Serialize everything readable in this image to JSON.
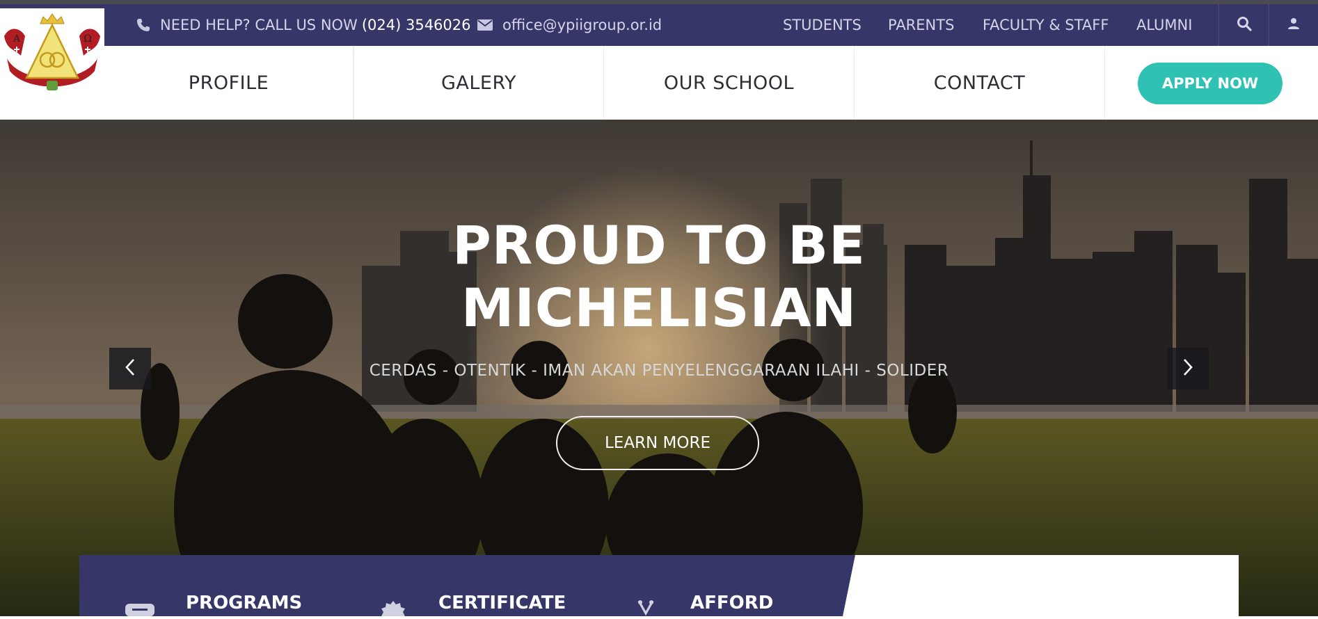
{
  "topbar": {
    "help_text": "NEED HELP? CALL US NOW",
    "phone": "(024) 3546026",
    "email": "office@ypiigroup.or.id",
    "links": [
      {
        "label": "STUDENTS"
      },
      {
        "label": "PARENTS"
      },
      {
        "label": "FACULTY & STAFF"
      },
      {
        "label": "ALUMNI"
      }
    ],
    "icons": {
      "phone": "phone-icon",
      "email": "envelope-icon",
      "search": "search-icon",
      "user": "user-icon"
    }
  },
  "logo": {
    "left_letter": "Α",
    "right_letter": "Ω"
  },
  "nav": {
    "items": [
      {
        "label": "PROFILE"
      },
      {
        "label": "GALERY"
      },
      {
        "label": "OUR SCHOOL"
      },
      {
        "label": "CONTACT"
      }
    ],
    "apply": "APPLY NOW"
  },
  "hero": {
    "title_line1": "PROUD TO BE",
    "title_line2": "MICHELISIAN",
    "subtitle": "CERDAS - OTENTIK - IMAN AKAN PENYELENGGARAAN ILAHI - SOLIDER",
    "button": "LEARN MORE",
    "prev_icon": "chevron-left-icon",
    "next_icon": "chevron-right-icon"
  },
  "features": [
    {
      "label": "PROGRAMS",
      "icon": "book-icon"
    },
    {
      "label": "CERTIFICATE",
      "icon": "badge-icon"
    },
    {
      "label": "AFFORD",
      "icon": "scissors-icon"
    }
  ],
  "colors": {
    "topbar_bg": "#373669",
    "accent": "#2fc1b3",
    "topbar_text": "#d4d4ea",
    "nav_text": "#2d2d36"
  }
}
